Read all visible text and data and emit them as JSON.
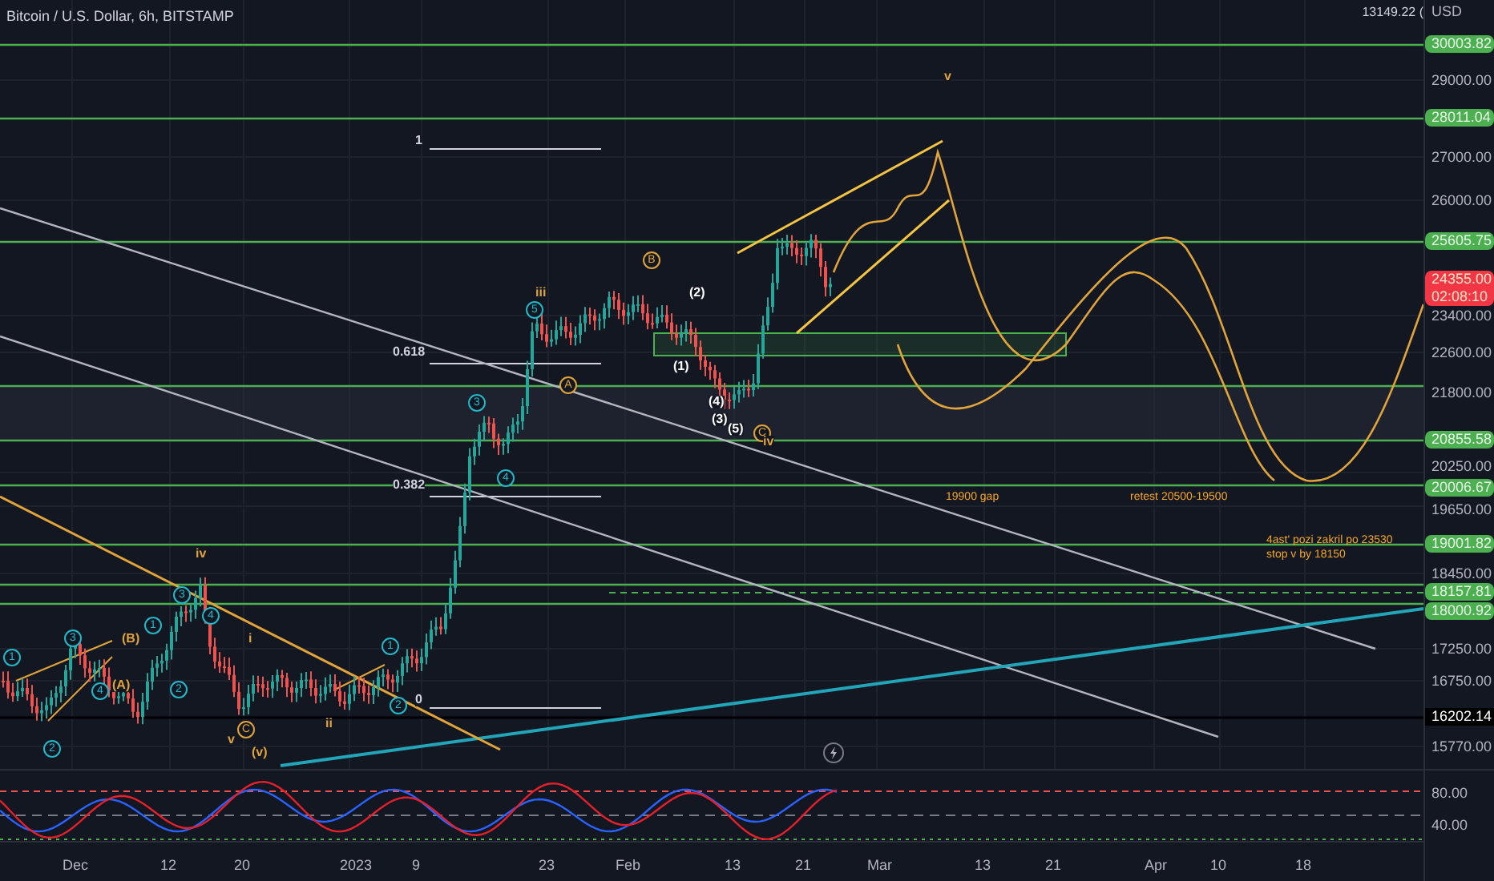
{
  "chart": {
    "title": "Bitcoin / U.S. Dollar, 6h, BITSTAMP",
    "high_marker": "13149.22 (",
    "annotations": [
      {
        "text": "1",
        "kind": "plain",
        "color": "#d1d4dc"
      },
      {
        "text": "0.618",
        "kind": "plain",
        "color": "#d1d4dc"
      },
      {
        "text": "0.382",
        "kind": "plain",
        "color": "#d1d4dc"
      },
      {
        "text": "0",
        "kind": "plain",
        "color": "#d1d4dc"
      },
      {
        "text": "iii",
        "kind": "plain",
        "color": "#e0a43a"
      },
      {
        "text": "B",
        "kind": "circled",
        "color": "#e0a43a"
      },
      {
        "text": "(2)",
        "kind": "plain",
        "color": "#ffffff"
      },
      {
        "text": "(1)",
        "kind": "plain",
        "color": "#ffffff"
      },
      {
        "text": "(4)",
        "kind": "plain",
        "color": "#ffffff"
      },
      {
        "text": "(3)",
        "kind": "plain",
        "color": "#ffffff"
      },
      {
        "text": "(5)",
        "kind": "plain",
        "color": "#ffffff"
      },
      {
        "text": "C",
        "kind": "circled",
        "color": "#e0a43a"
      },
      {
        "text": "iv",
        "kind": "plain",
        "color": "#e0a43a"
      },
      {
        "text": "v",
        "kind": "plain",
        "color": "#e0a43a"
      },
      {
        "text": "A",
        "kind": "circled",
        "color": "#e0a43a"
      },
      {
        "text": "5",
        "kind": "circled",
        "color": "#22b8c8"
      },
      {
        "text": "3",
        "kind": "circled",
        "color": "#22b8c8"
      },
      {
        "text": "4",
        "kind": "circled",
        "color": "#22b8c8"
      },
      {
        "text": "iv",
        "kind": "plain",
        "color": "#e0a43a"
      },
      {
        "text": "i",
        "kind": "plain",
        "color": "#e0a43a"
      },
      {
        "text": "ii",
        "kind": "plain",
        "color": "#e0a43a"
      },
      {
        "text": "v",
        "kind": "plain",
        "color": "#e0a43a"
      },
      {
        "text": "(v)",
        "kind": "plain",
        "color": "#e0a43a"
      },
      {
        "text": "C",
        "kind": "circled",
        "color": "#e0a43a"
      },
      {
        "text": "(B)",
        "kind": "plain",
        "color": "#e0a43a"
      },
      {
        "text": "(A)",
        "kind": "plain",
        "color": "#e0a43a"
      },
      {
        "text": "1",
        "kind": "circled",
        "color": "#22b8c8"
      },
      {
        "text": "2",
        "kind": "circled",
        "color": "#22b8c8"
      },
      {
        "text": "3",
        "kind": "circled",
        "color": "#22b8c8"
      },
      {
        "text": "4",
        "kind": "circled",
        "color": "#22b8c8"
      },
      {
        "text": "1",
        "kind": "circled",
        "color": "#22b8c8"
      },
      {
        "text": "2",
        "kind": "circled",
        "color": "#22b8c8"
      },
      {
        "text": "3",
        "kind": "circled",
        "color": "#22b8c8"
      },
      {
        "text": "4",
        "kind": "circled",
        "color": "#22b8c8"
      },
      {
        "text": "1",
        "kind": "circled",
        "color": "#22b8c8"
      },
      {
        "text": "2",
        "kind": "circled",
        "color": "#22b8c8"
      }
    ],
    "notes": [
      "19900 gap",
      "retest 20500-19500",
      "4ast' pozi zakril po 23530\nstop v by 18150"
    ]
  },
  "price_axis": [
    {
      "text": "USD",
      "kind": "unit"
    },
    {
      "text": "30003.82",
      "kind": "line"
    },
    {
      "text": "29000.00",
      "kind": "tick"
    },
    {
      "text": "28011.04",
      "kind": "line"
    },
    {
      "text": "27000.00",
      "kind": "tick"
    },
    {
      "text": "26000.00",
      "kind": "tick"
    },
    {
      "text": "25605.75",
      "kind": "line"
    },
    {
      "text": "24355.00",
      "kind": "price",
      "countdown": "02:08:10"
    },
    {
      "text": "23400.00",
      "kind": "tick"
    },
    {
      "text": "22600.00",
      "kind": "tick"
    },
    {
      "text": "21800.00",
      "kind": "tick"
    },
    {
      "text": "20855.58",
      "kind": "line"
    },
    {
      "text": "20250.00",
      "kind": "tick"
    },
    {
      "text": "20006.67",
      "kind": "line"
    },
    {
      "text": "19650.00",
      "kind": "tick"
    },
    {
      "text": "19001.82",
      "kind": "line"
    },
    {
      "text": "18450.00",
      "kind": "tick"
    },
    {
      "text": "18157.81",
      "kind": "line"
    },
    {
      "text": "18000.92",
      "kind": "line"
    },
    {
      "text": "17250.00",
      "kind": "tick"
    },
    {
      "text": "16750.00",
      "kind": "tick"
    },
    {
      "text": "16202.14",
      "kind": "marker"
    },
    {
      "text": "15770.00",
      "kind": "tick"
    }
  ],
  "oscillator_axis": [
    "80.00",
    "40.00"
  ],
  "time_axis": [
    "Dec",
    "12",
    "20",
    "2023",
    "9",
    "23",
    "Feb",
    "13",
    "21",
    "Mar",
    "13",
    "21",
    "Apr",
    "10",
    "18"
  ]
}
